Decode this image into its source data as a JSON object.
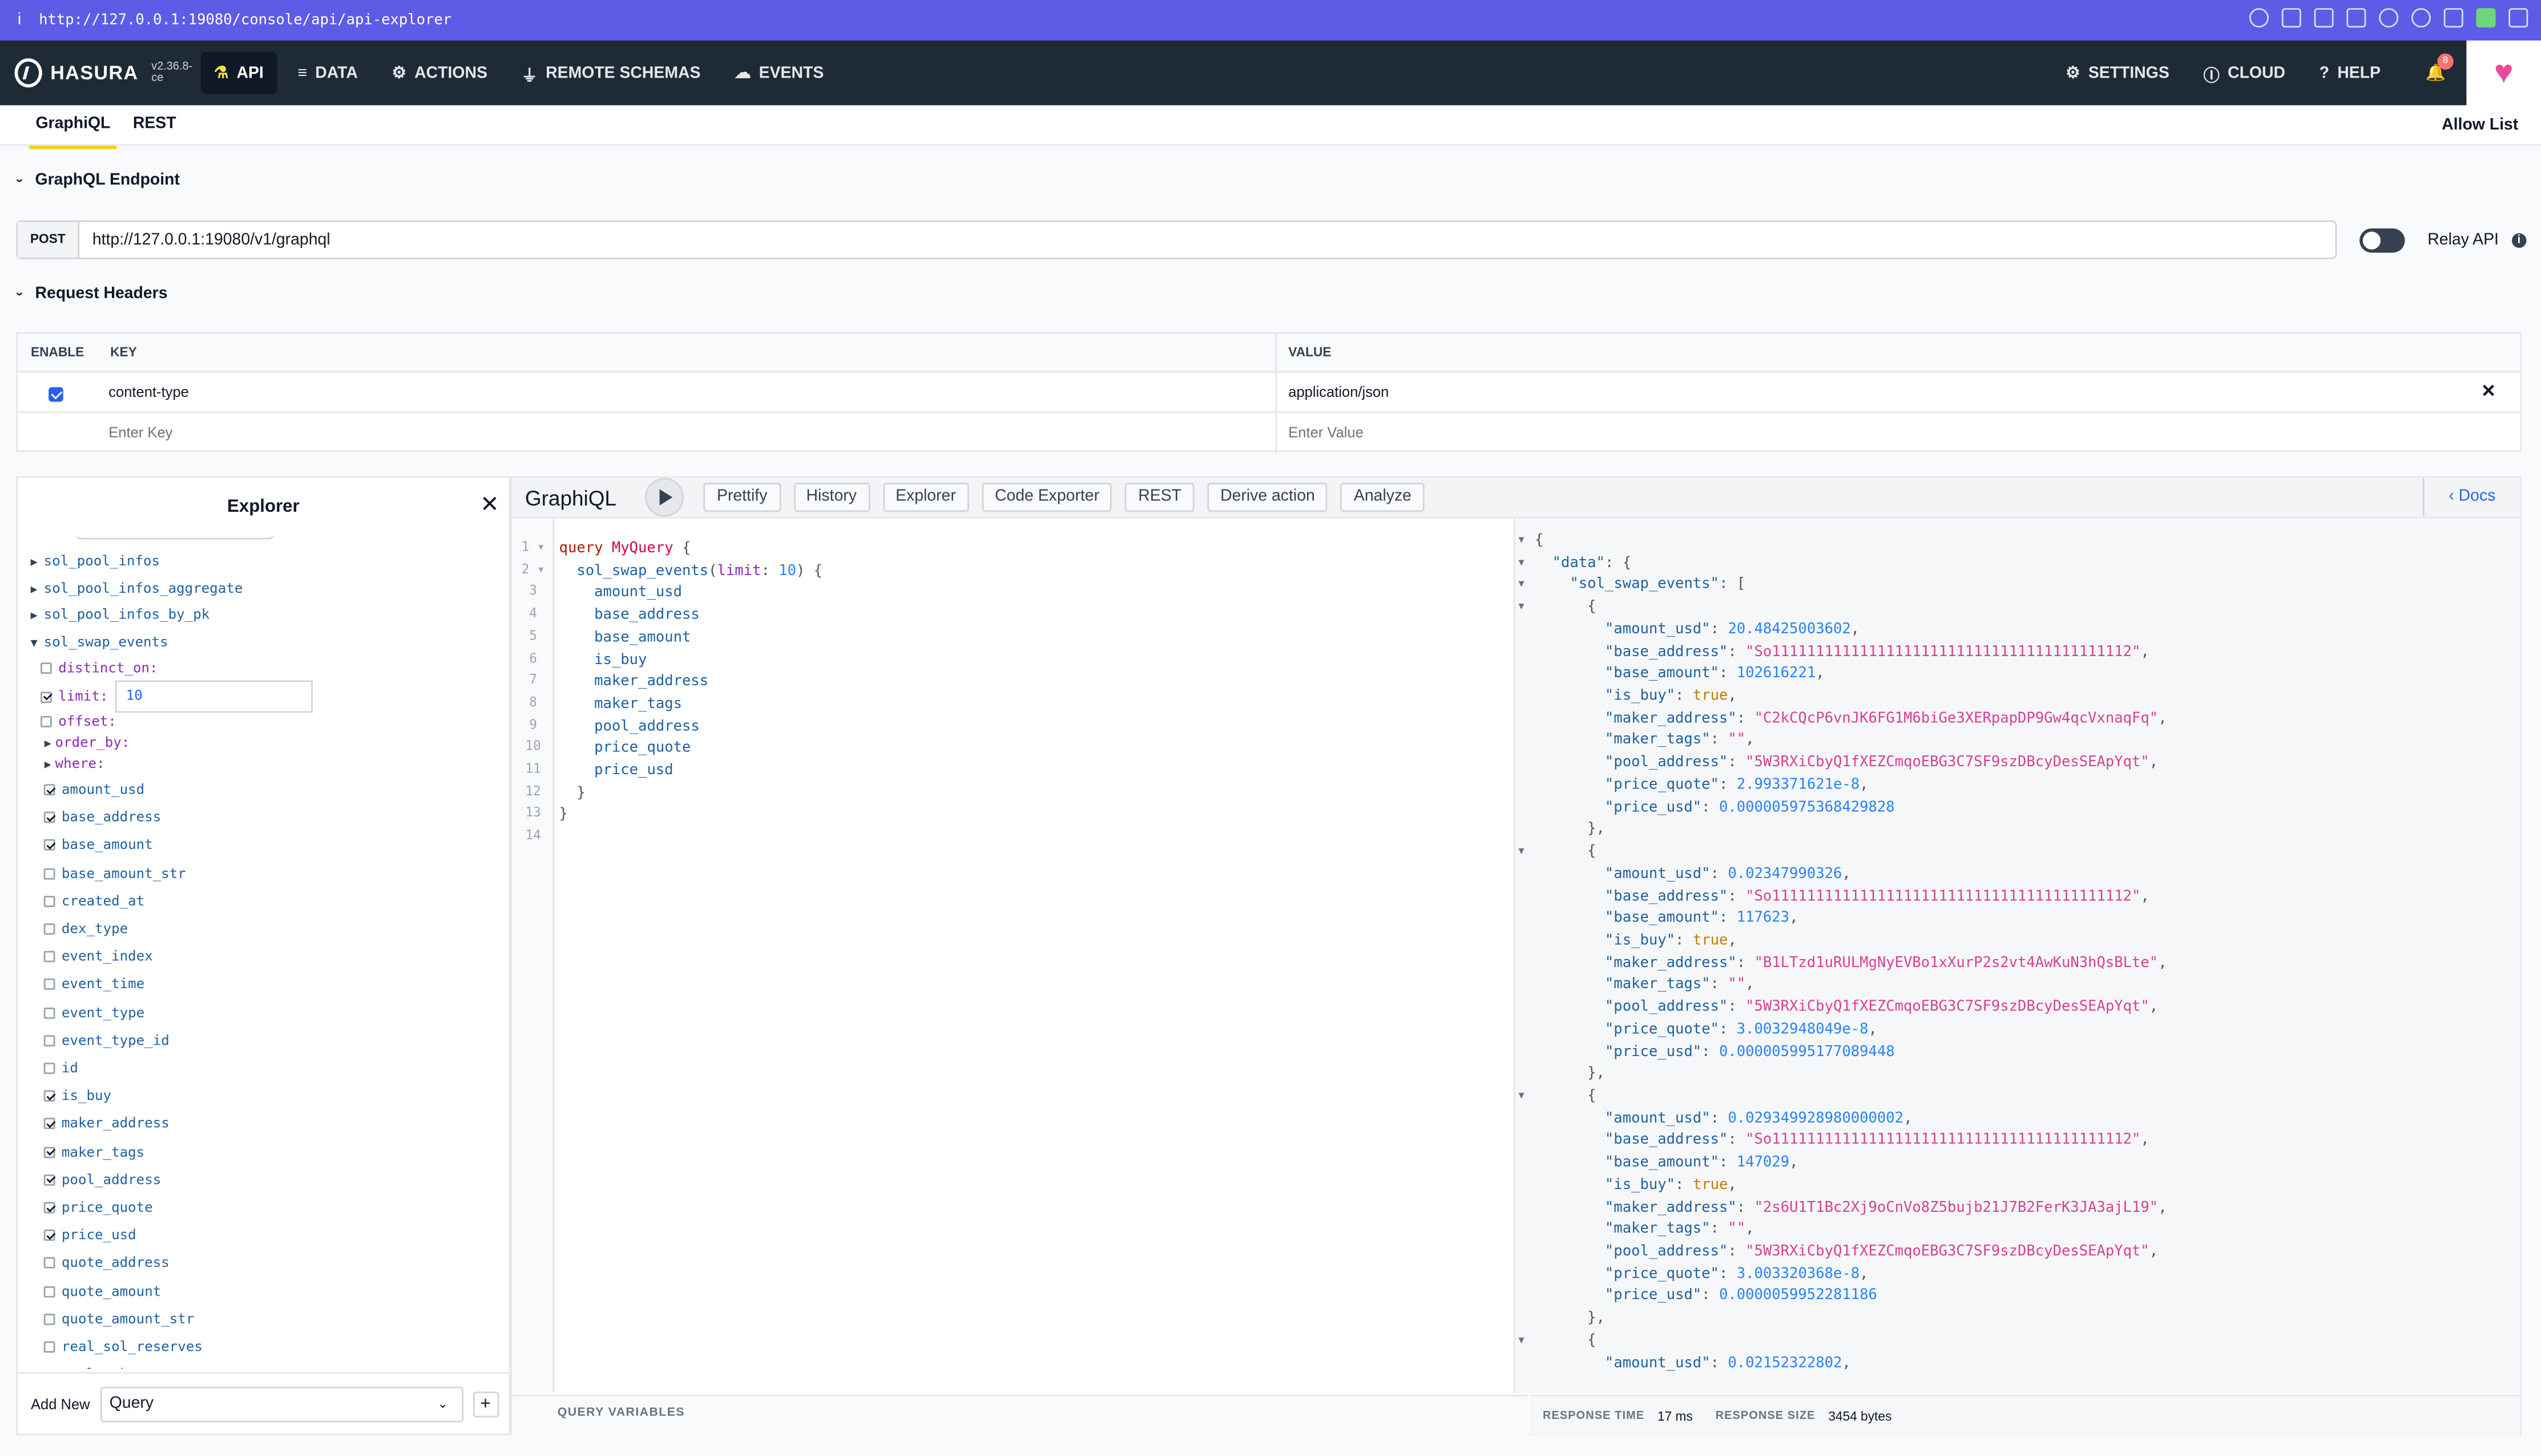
{
  "browser": {
    "url": "http://127.0.0.1:19080/console/api/api-explorer",
    "info": "i"
  },
  "nav": {
    "brand": "HASURA",
    "version": "v2.36.8-ce",
    "items": [
      {
        "label": "API"
      },
      {
        "label": "DATA"
      },
      {
        "label": "ACTIONS"
      },
      {
        "label": "REMOTE SCHEMAS"
      },
      {
        "label": "EVENTS"
      }
    ],
    "right": {
      "settings": "SETTINGS",
      "cloud": "CLOUD",
      "help": "HELP",
      "notifications": "8"
    }
  },
  "subtabs": {
    "graphiql": "GraphiQL",
    "rest": "REST",
    "allow_list": "Allow List"
  },
  "endpoint": {
    "section": "GraphQL Endpoint",
    "method": "POST",
    "url": "http://127.0.0.1:19080/v1/graphql",
    "relay": "Relay API"
  },
  "headers": {
    "section": "Request Headers",
    "cols": {
      "enable": "ENABLE",
      "key": "KEY",
      "value": "VALUE"
    },
    "row": {
      "key": "content-type",
      "value": "application/json"
    },
    "placeholders": {
      "key": "Enter Key",
      "value": "Enter Value"
    }
  },
  "explorer": {
    "title": "Explorer",
    "add_new": "Add New",
    "operation_type": "Query",
    "limit_value": "10",
    "roots": [
      "sol_pool_infos",
      "sol_pool_infos_aggregate",
      "sol_pool_infos_by_pk",
      "sol_swap_events"
    ],
    "args": [
      "distinct_on:",
      "limit:",
      "offset:",
      "order_by:",
      "where:"
    ],
    "fields": [
      {
        "name": "amount_usd",
        "checked": true
      },
      {
        "name": "base_address",
        "checked": true
      },
      {
        "name": "base_amount",
        "checked": true
      },
      {
        "name": "base_amount_str",
        "checked": false
      },
      {
        "name": "created_at",
        "checked": false
      },
      {
        "name": "dex_type",
        "checked": false
      },
      {
        "name": "event_index",
        "checked": false
      },
      {
        "name": "event_time",
        "checked": false
      },
      {
        "name": "event_type",
        "checked": false
      },
      {
        "name": "event_type_id",
        "checked": false
      },
      {
        "name": "id",
        "checked": false
      },
      {
        "name": "is_buy",
        "checked": true
      },
      {
        "name": "maker_address",
        "checked": true
      },
      {
        "name": "maker_tags",
        "checked": true
      },
      {
        "name": "pool_address",
        "checked": true
      },
      {
        "name": "price_quote",
        "checked": true
      },
      {
        "name": "price_usd",
        "checked": true
      },
      {
        "name": "quote_address",
        "checked": false
      },
      {
        "name": "quote_amount",
        "checked": false
      },
      {
        "name": "quote_amount_str",
        "checked": false
      },
      {
        "name": "real_sol_reserves",
        "checked": false
      },
      {
        "name": "real_token_reserves",
        "checked": false
      }
    ]
  },
  "graphiql": {
    "title": "GraphiQL",
    "buttons": [
      "Prettify",
      "History",
      "Explorer",
      "Code Exporter",
      "REST",
      "Derive action",
      "Analyze"
    ],
    "docs": "Docs",
    "query_variables": "QUERY VARIABLES",
    "query_name": "MyQuery",
    "root_field": "sol_swap_events",
    "limit_value": "10",
    "query_fields": [
      "amount_usd",
      "base_address",
      "base_amount",
      "is_buy",
      "maker_address",
      "maker_tags",
      "pool_address",
      "price_quote",
      "price_usd"
    ]
  },
  "response": {
    "time_label": "RESPONSE TIME",
    "time": "17 ms",
    "size_label": "RESPONSE SIZE",
    "size": "3454 bytes",
    "records": [
      {
        "amount_usd": "20.48425003602",
        "base_address": "\"So11111111111111111111111111111111111111112\"",
        "base_amount": "102616221",
        "is_buy": "true",
        "maker_address": "\"C2kCQcP6vnJK6FG1M6biGe3XERpapDP9Gw4qcVxnaqFq\"",
        "maker_tags": "\"\"",
        "pool_address": "\"5W3RXiCbyQ1fXEZCmqoEBG3C7SF9szDBcyDesSEApYqt\"",
        "price_quote": "2.993371621e-8",
        "price_usd": "0.000005975368429828"
      },
      {
        "amount_usd": "0.02347990326",
        "base_address": "\"So11111111111111111111111111111111111111112\"",
        "base_amount": "117623",
        "is_buy": "true",
        "maker_address": "\"B1LTzd1uRULMgNyEVBo1xXurP2s2vt4AwKuN3hQsBLte\"",
        "maker_tags": "\"\"",
        "pool_address": "\"5W3RXiCbyQ1fXEZCmqoEBG3C7SF9szDBcyDesSEApYqt\"",
        "price_quote": "3.0032948049e-8",
        "price_usd": "0.000005995177089448"
      },
      {
        "amount_usd": "0.029349928980000002",
        "base_address": "\"So11111111111111111111111111111111111111112\"",
        "base_amount": "147029",
        "is_buy": "true",
        "maker_address": "\"2s6U1T1Bc2Xj9oCnVo8Z5bujb21J7B2FerK3JA3ajL19\"",
        "maker_tags": "\"\"",
        "pool_address": "\"5W3RXiCbyQ1fXEZCmqoEBG3C7SF9szDBcyDesSEApYqt\"",
        "price_quote": "3.003320368e-8",
        "price_usd": "0.0000059952281186"
      },
      {
        "amount_usd": "0.02152322802"
      }
    ]
  }
}
